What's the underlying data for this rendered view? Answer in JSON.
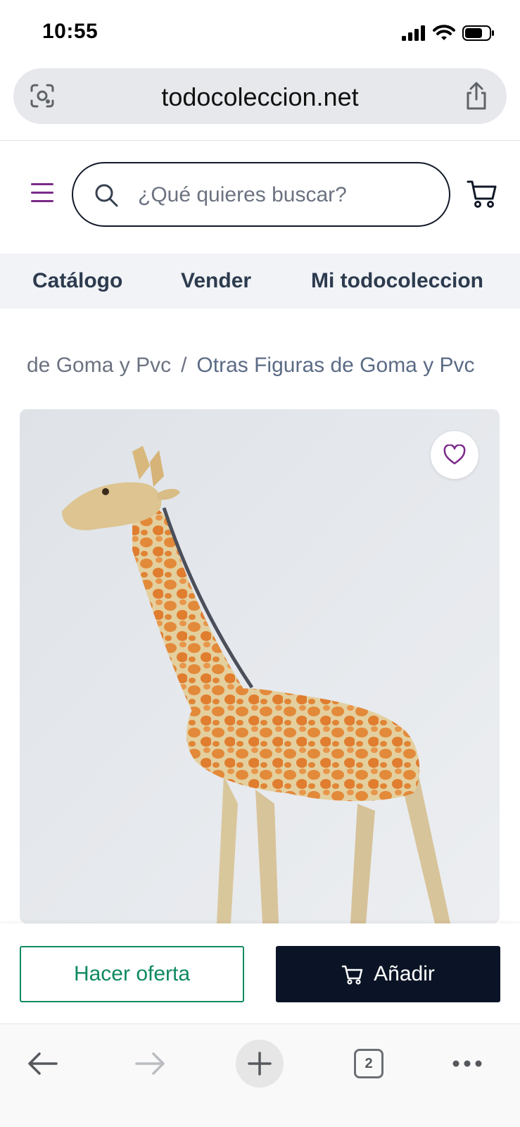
{
  "status_bar": {
    "time": "10:55"
  },
  "browser": {
    "url": "todocoleccion.net"
  },
  "header": {
    "search_placeholder": "¿Qué quieres buscar?"
  },
  "nav": {
    "items": [
      {
        "label": "Catálogo"
      },
      {
        "label": "Vender"
      },
      {
        "label": "Mi todocoleccion"
      }
    ]
  },
  "breadcrumb": {
    "previous": "de Goma y Pvc",
    "separator": "/",
    "current": "Otras Figuras de Goma y Pvc"
  },
  "product": {
    "image_subject": "giraffe-figure",
    "favorite": false
  },
  "actions": {
    "offer_label": "Hacer oferta",
    "add_label": "Añadir"
  },
  "toolbar": {
    "tab_count": "2"
  },
  "colors": {
    "brand_purple": "#7b2a8a",
    "offer_green": "#0f8a5f",
    "add_dark": "#0b1426",
    "nav_bg": "#f1f3f6"
  }
}
